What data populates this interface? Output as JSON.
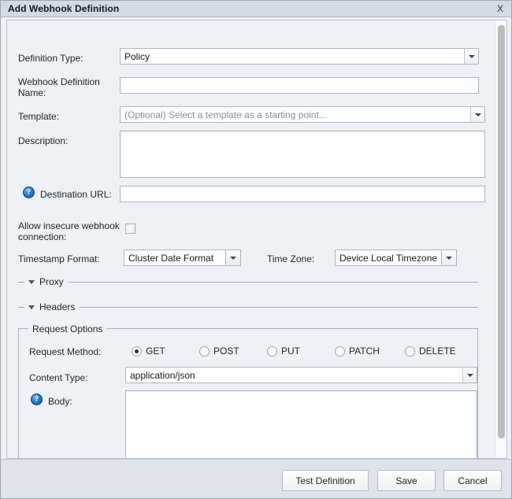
{
  "window": {
    "title": "Add Webhook Definition",
    "close_label": "X"
  },
  "form": {
    "definition_type": {
      "label": "Definition Type:",
      "value": "Policy"
    },
    "webhook_definition_name": {
      "label": "Webhook Definition Name:",
      "value": "",
      "placeholder": ""
    },
    "template": {
      "label": "Template:",
      "value": "(Optional) Select a template as a starting point..."
    },
    "description": {
      "label": "Description:",
      "value": ""
    },
    "destination_url": {
      "label": "Destination URL:",
      "value": "",
      "help_icon": "help-icon"
    },
    "allow_insecure": {
      "label": "Allow insecure webhook connection:",
      "checked": false
    },
    "timestamp_format": {
      "label": "Timestamp Format:",
      "value": "Cluster Date Format"
    },
    "time_zone": {
      "label": "Time Zone:",
      "value": "Device Local Timezone"
    },
    "sections": [
      {
        "label": "Proxy",
        "expanded": true
      },
      {
        "label": "Headers",
        "expanded": true
      }
    ],
    "request_options": {
      "title": "Request Options",
      "request_method": {
        "label": "Request Method:",
        "selected": "GET",
        "options": [
          "GET",
          "POST",
          "PUT",
          "PATCH",
          "DELETE"
        ]
      },
      "content_type": {
        "label": "Content Type:",
        "value": "application/json"
      },
      "body": {
        "label": "Body:",
        "value": "",
        "help_icon": "help-icon"
      }
    }
  },
  "footer": {
    "test_definition": "Test Definition",
    "save": "Save",
    "cancel": "Cancel"
  },
  "colors": {
    "titlebar": "#d3dae5",
    "panel": "#eef1f5",
    "footer": "#dfe4ec",
    "field_border": "#a8b6c8",
    "help_blue": "#2b7fc4"
  }
}
